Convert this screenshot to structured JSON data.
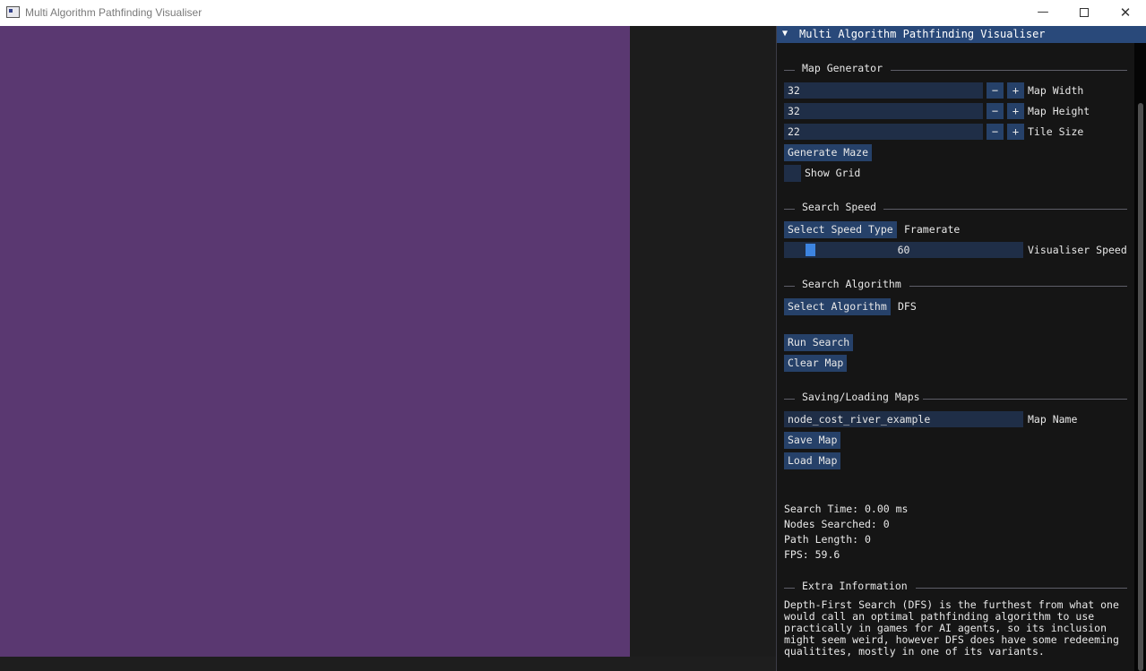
{
  "window": {
    "title": "Multi Algorithm Pathfinding Visualiser",
    "minimize_glyph": "—",
    "close_glyph": "✕"
  },
  "colors": {
    "map_background": "#5a3871",
    "panel_header": "#29497a",
    "button": "#264169",
    "frame": "#1f2e47",
    "slider_grab": "#3d84e0"
  },
  "panel": {
    "collapse_glyph": "▼",
    "title": "Multi Algorithm Pathfinding Visualiser",
    "map_generator": {
      "header": "Map Generator",
      "minus": "−",
      "plus": "+",
      "map_width": {
        "value": "32",
        "label": "Map Width"
      },
      "map_height": {
        "value": "32",
        "label": "Map Height"
      },
      "tile_size": {
        "value": "22",
        "label": "Tile Size"
      },
      "generate_maze": "Generate Maze",
      "show_grid": {
        "label": "Show Grid",
        "checked": false
      }
    },
    "search_speed": {
      "header": "Search Speed",
      "select_button": "Select Speed Type",
      "selected": "Framerate",
      "slider_value": "60",
      "slider_label": "Visualiser Speed"
    },
    "search_algorithm": {
      "header": "Search Algorithm",
      "select_button": "Select Algorithm",
      "selected": "DFS",
      "run_search": "Run Search",
      "clear_map": "Clear Map"
    },
    "saving_loading": {
      "header": "Saving/Loading Maps",
      "map_name_value": "node_cost_river_example",
      "map_name_label": "Map Name",
      "save_map": "Save Map",
      "load_map": "Load Map"
    },
    "stats": {
      "search_time": "Search Time: 0.00 ms",
      "nodes_searched": "Nodes Searched: 0",
      "path_length": "Path Length: 0",
      "fps": "FPS: 59.6"
    },
    "extra_info": {
      "header": "Extra Information",
      "text": "Depth-First Search (DFS) is the furthest from what one would call an optimal pathfinding algorithm to use practically in games for AI agents, so its inclusion might seem weird, however DFS does have some redeeming qualitites, mostly in one of its variants."
    }
  }
}
